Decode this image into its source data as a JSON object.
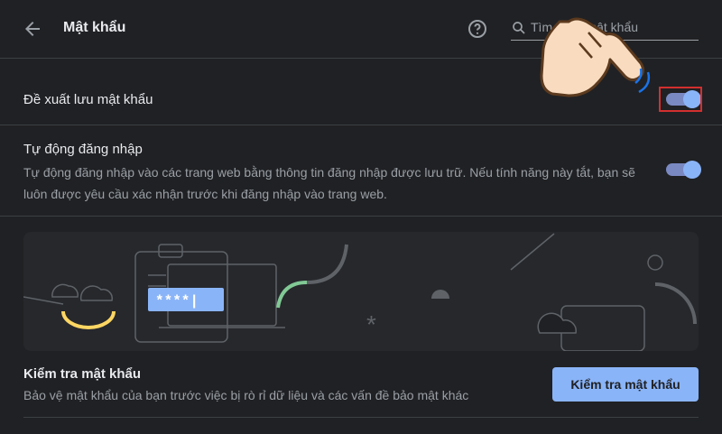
{
  "header": {
    "title": "Mật khẩu",
    "search_placeholder": "Tìm kiếm mật khẩu",
    "icons": {
      "back": "arrow-left-icon",
      "help": "question-circle-icon",
      "search": "search-icon"
    }
  },
  "offer_to_save": {
    "label": "Đề xuất lưu mật khẩu",
    "enabled": true
  },
  "auto_sign_in": {
    "label": "Tự động đăng nhập",
    "description": "Tự động đăng nhập vào các trang web bằng thông tin đăng nhập được lưu trữ. Nếu tính năng này tắt, bạn sẽ luôn được yêu cầu xác nhận trước khi đăng nhập vào trang web.",
    "enabled": true
  },
  "illustration": {
    "password_mask": "****|"
  },
  "check_passwords": {
    "label": "Kiểm tra mật khẩu",
    "description": "Bảo vệ mật khẩu của bạn trước việc bị rò rỉ dữ liệu và các vấn đề bảo mật khác",
    "button_label": "Kiểm tra mật khẩu"
  },
  "colors": {
    "background": "#202124",
    "accent": "#8ab4f8",
    "highlight": "#d32f2f",
    "hand": "#f9dcc0"
  }
}
